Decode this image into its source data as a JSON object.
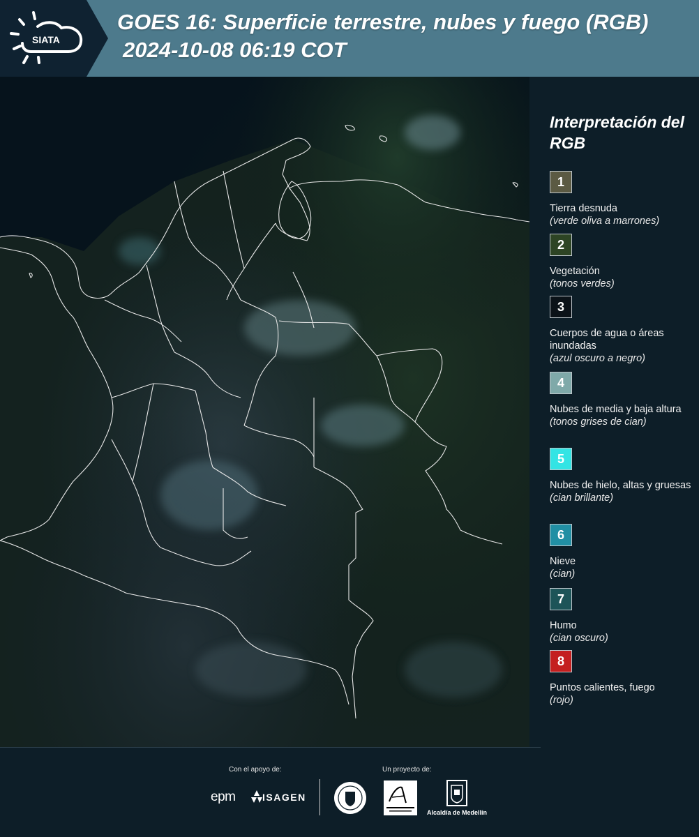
{
  "header": {
    "logo_text": "SIATA",
    "title_line1": "GOES 16: Superficie terrestre, nubes y fuego (RGB)",
    "title_line2": "2024-10-08 06:19 COT"
  },
  "map": {
    "boundary_color": "#e8e8e8",
    "background_color": "#06131c"
  },
  "legend": {
    "title": "Interpretación del RGB",
    "items": [
      {
        "number": "1",
        "label": "Tierra desnuda",
        "sub": "(verde oliva a marrones)",
        "color": "#5b5a43"
      },
      {
        "number": "2",
        "label": "Vegetación",
        "sub": "(tonos verdes)",
        "color": "#2d4424"
      },
      {
        "number": "3",
        "label": "Cuerpos de agua o áreas inundadas",
        "sub": "(azul oscuro a negro)",
        "color": "#0b1218"
      },
      {
        "number": "4",
        "label": "Nubes de media y baja altura",
        "sub": "(tonos grises de cian)",
        "color": "#7fa9a9"
      },
      {
        "number": "5",
        "label": "Nubes de hielo, altas y gruesas",
        "sub": "(cian brillante)",
        "color": "#33e4e4"
      },
      {
        "number": "6",
        "label": "Nieve",
        "sub": "(cian)",
        "color": "#218fa4"
      },
      {
        "number": "7",
        "label": "Humo",
        "sub": "(cian oscuro)",
        "color": "#1d5458"
      },
      {
        "number": "8",
        "label": "Puntos calientes, fuego",
        "sub": "(rojo)",
        "color": "#c41f1f"
      }
    ]
  },
  "footer": {
    "support_label": "Con el apoyo de:",
    "project_label": "Un proyecto de:",
    "epm": "epm",
    "isagen": "ISAGEN",
    "alcaldia": "Alcaldía de Medellín"
  }
}
